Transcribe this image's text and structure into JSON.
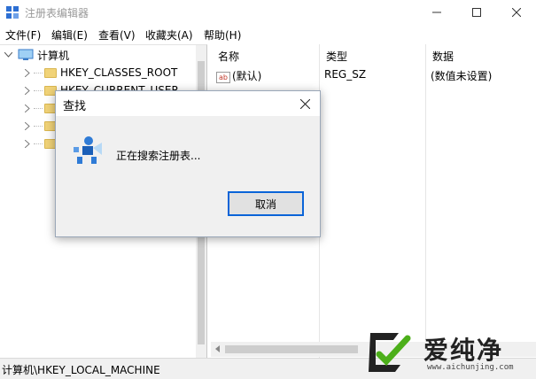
{
  "window": {
    "title": "注册表编辑器"
  },
  "menu": [
    "文件(F)",
    "编辑(E)",
    "查看(V)",
    "收藏夹(A)",
    "帮助(H)"
  ],
  "tree": {
    "root": "计算机",
    "items": [
      {
        "label": "HKEY_CLASSES_ROOT"
      },
      {
        "label": "HKEY_CURRENT_USER"
      },
      {
        "label": ""
      },
      {
        "label": ""
      },
      {
        "label": ""
      }
    ]
  },
  "list": {
    "columns": [
      "名称",
      "类型",
      "数据"
    ],
    "rows": [
      {
        "name": "(默认)",
        "type": "REG_SZ",
        "data": "(数值未设置)",
        "icon": "ab-icon"
      }
    ]
  },
  "status": {
    "path": "计算机\\HKEY_LOCAL_MACHINE"
  },
  "dialog": {
    "title": "查找",
    "message": "正在搜索注册表...",
    "cancel_label": "取消"
  },
  "watermark": {
    "brand": "爱纯净",
    "url": "www.aichunjing.com"
  },
  "colors": {
    "folder": "#f1d378",
    "button_border": "#0a64d8",
    "dialog_bg": "#f0f0f0",
    "logo_green": "#4caf1a"
  }
}
